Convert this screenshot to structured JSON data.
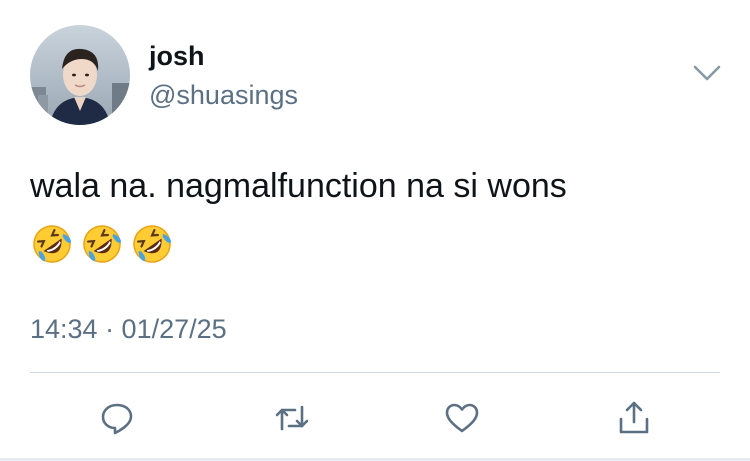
{
  "tweet": {
    "author": {
      "display_name": "josh",
      "handle": "@shuasings"
    },
    "text": "wala na. nagmalfunction na si wons",
    "emojis": [
      "rolling-on-floor-laughing-emoji",
      "rolling-on-floor-laughing-emoji",
      "rolling-on-floor-laughing-emoji"
    ],
    "timestamp": "14:34 · 01/27/25"
  },
  "actions": [
    {
      "icon": "reply-icon"
    },
    {
      "icon": "retweet-icon"
    },
    {
      "icon": "like-icon"
    },
    {
      "icon": "share-icon"
    }
  ],
  "colors": {
    "text_primary": "#0f1419",
    "text_secondary": "#5b7083",
    "icon": "#5b7083",
    "divider": "#cfd9de",
    "emoji_face": "#ffcc33",
    "emoji_tears": "#4aa3df"
  }
}
